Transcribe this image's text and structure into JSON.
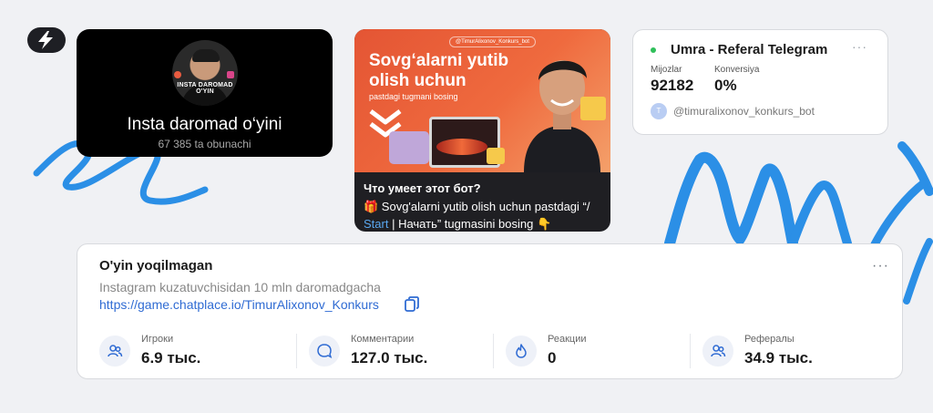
{
  "insta_card": {
    "avatar_caption": "INSTA DAROMAD O'YIN",
    "title": "Insta daromad o‘yini",
    "followers": "67 385",
    "followers_label": "ta obunachi"
  },
  "telegram_card": {
    "banner_handle": "@TimurAlixonov_Konkurs_bot",
    "banner_headline": "Sovg‘alarni yutib olish uchun",
    "banner_small": "pastdagi tugmani bosing",
    "question": "Что умеет этот бот?",
    "desc_part1": "🎁 Sovg'alarni yutib olish uchun pastdagi “/",
    "desc_link": "Start",
    "desc_part2": " | Начать” tugmasini bosing 👇"
  },
  "referral_card": {
    "title": "Umra - Referal Telegram",
    "menu": "···",
    "clients_label": "Mijozlar",
    "clients_value": "92182",
    "conversion_label": "Konversiya",
    "conversion_value": "0%",
    "bot_avatar_letter": "T",
    "bot_handle": "@timuralixonov_konkurs_bot",
    "status_color": "#2fbf5a"
  },
  "game_card": {
    "title": "O'yin yoqilmagan",
    "menu": "···",
    "subtitle": "Instagram kuzatuvchisidan 10 mln daromadgacha",
    "link": "https://game.chatplace.io/TimurAlixonov_Konkurs",
    "stats": [
      {
        "label": "Игроки",
        "value": "6.9 тыс.",
        "icon": "users-icon"
      },
      {
        "label": "Комментарии",
        "value": "127.0 тыс.",
        "icon": "comment-icon"
      },
      {
        "label": "Реакции",
        "value": "0",
        "icon": "flame-icon"
      },
      {
        "label": "Рефералы",
        "value": "34.9 тыс.",
        "icon": "referrals-icon"
      }
    ]
  },
  "colors": {
    "background": "#f0f1f4",
    "accent_blue": "#2b8fe6",
    "link": "#2f6bd3"
  }
}
